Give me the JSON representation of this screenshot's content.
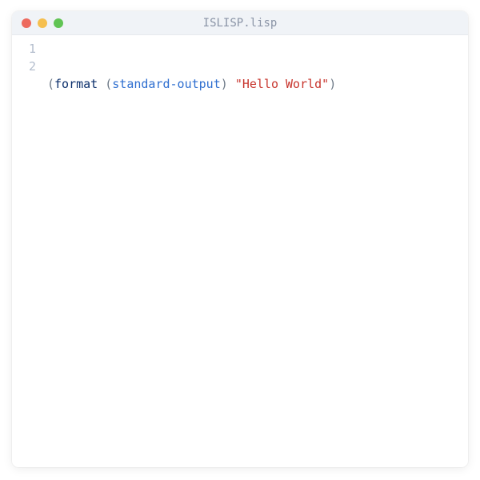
{
  "window": {
    "title": "ISLISP.lisp"
  },
  "gutter": {
    "line1": "1",
    "line2": "2"
  },
  "code": {
    "paren_open1": "(",
    "keyword_format": "format",
    "space1": " ",
    "paren_open2": "(",
    "func_stdout": "standard-output",
    "paren_close1": ")",
    "space2": " ",
    "string_hello": "\"Hello World\"",
    "paren_close2": ")"
  }
}
